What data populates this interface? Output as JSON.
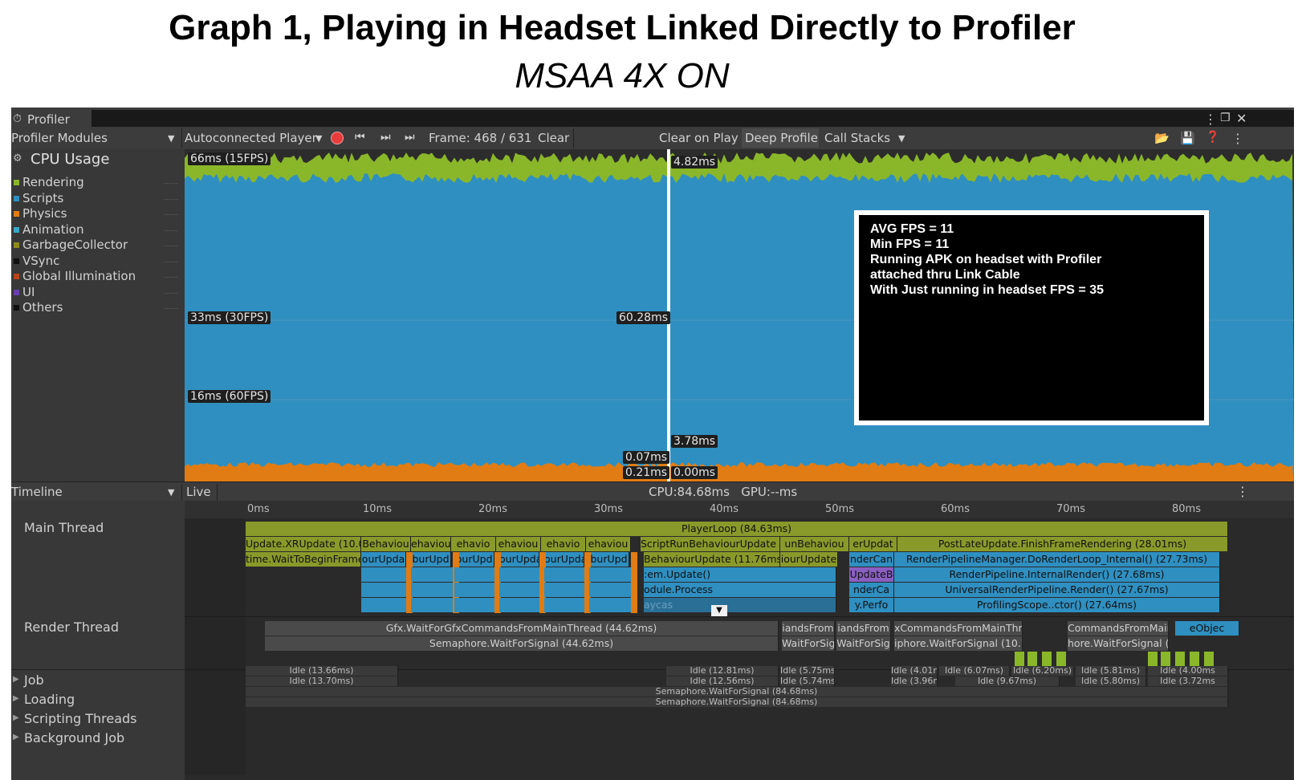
{
  "heading": {
    "title": "Graph 1, Playing in Headset Linked Directly to Profiler",
    "subtitle": "MSAA 4X ON"
  },
  "window": {
    "tab_title": "Profiler",
    "icons": [
      "more-icon",
      "maximize-icon",
      "close-icon"
    ]
  },
  "toolbar": {
    "modules_dropdown": "Profiler Modules",
    "player_dropdown": "Autoconnected Player",
    "frame_label": "Frame: 468 / 631",
    "clear": "Clear",
    "clear_on_play": "Clear on Play",
    "deep_profile": "Deep Profile",
    "call_stacks": "Call Stacks",
    "colors": {
      "record": "#e83b3b",
      "deep_profile_active": "#4a4a4a"
    }
  },
  "cpu_module": {
    "title": "CPU Usage",
    "categories": [
      {
        "name": "Rendering",
        "color": "#8ab72a"
      },
      {
        "name": "Scripts",
        "color": "#2f8fc0"
      },
      {
        "name": "Physics",
        "color": "#e07c13"
      },
      {
        "name": "Animation",
        "color": "#3aa6c6"
      },
      {
        "name": "GarbageCollector",
        "color": "#8c8a1a"
      },
      {
        "name": "VSync",
        "color": "#101010"
      },
      {
        "name": "Global Illumination",
        "color": "#b8431a"
      },
      {
        "name": "UI",
        "color": "#6a3fb0"
      },
      {
        "name": "Others",
        "color": "#101010"
      }
    ],
    "graph_labels": {
      "ms66": "66ms (15FPS)",
      "ms33": "33ms (30FPS)",
      "ms16": "16ms (60FPS)",
      "sel_top": "4.82ms",
      "sel_mid": "60.28ms",
      "sel_low": "3.78ms",
      "sel_a": "0.07ms",
      "sel_b": "0.21ms",
      "sel_c": "0.00ms"
    }
  },
  "info_box": {
    "lines": [
      "AVG FPS = 11",
      "Min FPS = 11",
      "Running APK on headset with Profiler",
      "attached thru Link Cable",
      "With Just running in headset FPS = 35"
    ]
  },
  "timeline": {
    "view_dropdown": "Timeline",
    "live": "Live",
    "cpu_gpu": "CPU:84.68ms   GPU:--ms",
    "ticks": [
      "0ms",
      "10ms",
      "20ms",
      "30ms",
      "40ms",
      "50ms",
      "60ms",
      "70ms",
      "80ms"
    ],
    "threads": {
      "main": "Main Thread",
      "render": "Render Thread",
      "job": "Job",
      "loading": "Loading",
      "scripting": "Scripting Threads",
      "background": "Background Job"
    },
    "main_bars": {
      "playerloop": "PlayerLoop (84.63ms)",
      "xrupdate": "Update.XRUpdate (10.00",
      "waittobegin": "time.WaitToBeginFrame",
      "behav_short": "Behaviou",
      "behav_s1": "ehaviou",
      "behav_s2": "ehavio",
      "ourupda": "ourUpda",
      "burupd": "burUpd",
      "scriptrun": "ScriptRunBehaviourUpdate (11",
      "unbehav": "unBehaviou",
      "erupdat": "erUpdat",
      "postlate": "PostLateUpdate.FinishFrameRendering (28.01ms)",
      "behaviourupdate": "BehaviourUpdate (11.76ms)",
      "ourupdate": "iourUpdate",
      "ndercan": "nderCan",
      "renderpipeline_mgr": "RenderPipelineManager.DoRenderLoop_Internal() (27.73ms)",
      "emupdate": ":em.Update()",
      "updateb": "UpdateB",
      "renderpipeline_int": "RenderPipeline.InternalRender() (27.68ms)",
      "moduleprocess": "odule.Process",
      "nderca": "nderCa",
      "universal": "UniversalRenderPipeline.Render() (27.67ms)",
      "raycas": "aycas",
      "yperfo": "y.Perfo",
      "profilingscope": "ProfilingScope..ctor() (27.64ms)"
    },
    "render_bars": {
      "gfxwait": "Gfx.WaitForGfxCommandsFromMainThread (44.62ms)",
      "handsfrom1": "iandsFrom",
      "handsfrom2": "iandsFrom",
      "xcommands": "xCommandsFromMainThr",
      "commandsfrommain": "CommandsFromMain",
      "eobjec": "eObjec",
      "semwait": "Semaphore.WaitForSignal (44.62ms)",
      "waitforsig1": "WaitForSig",
      "waitforsig2": "WaitForSig",
      "phorewait": "iphore.WaitForSignal (10.7",
      "horewait": "hore.WaitForSignal (8"
    },
    "job_row1": [
      "Idle (13.66ms)",
      "Idle (12.81ms)",
      "Idle (5.75ms)",
      "Idle (4.01ms",
      "Idle (6.07ms)",
      "Idle (6.20ms)",
      "Idle (5.81ms)",
      "Idle (4.00ms"
    ],
    "job_row2": [
      "Idle (13.70ms)",
      "Idle (12.56ms)",
      "Idle (5.74ms)",
      "Idle (3.96ms",
      "Idle (9.67ms)",
      "Idle (5.80ms)",
      "Idle (3.72ms"
    ],
    "loading_row": "Semaphore.WaitForSignal (84.68ms)",
    "scripting_row": "Semaphore.WaitForSignal (84.68ms)"
  }
}
